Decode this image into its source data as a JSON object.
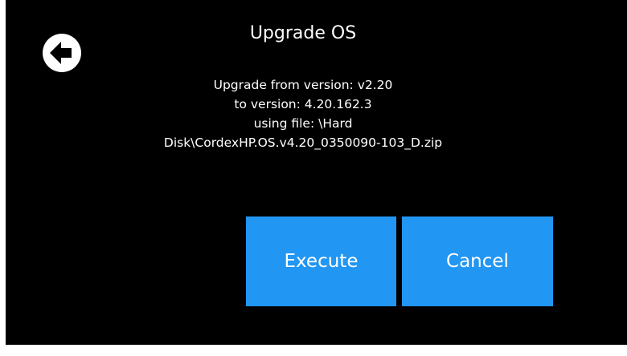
{
  "dialog": {
    "title": "Upgrade OS",
    "back_icon": "back-arrow-circle-icon",
    "message_lines": [
      "Upgrade from version: v2.20",
      "to version: 4.20.162.3",
      "using file: \\Hard",
      "Disk\\CordexHP.OS.v4.20_0350090-103_D.zip"
    ],
    "execute_label": "Execute",
    "cancel_label": "Cancel"
  },
  "colors": {
    "background": "#000000",
    "text": "#ffffff",
    "button": "#2196f3"
  }
}
